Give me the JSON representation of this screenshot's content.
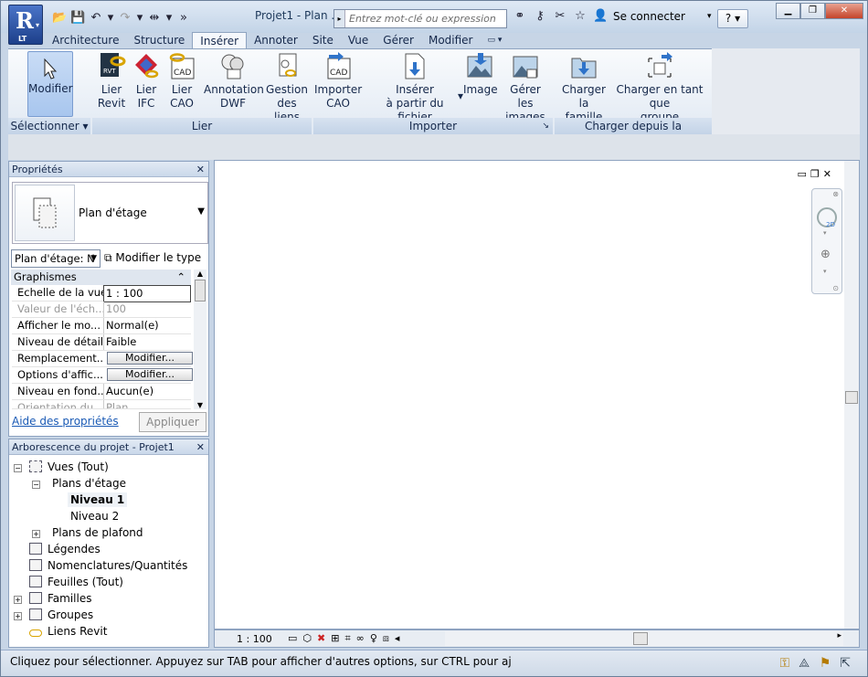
{
  "app": {
    "title": "Projet1 - Plan ...",
    "logo_letter": "R",
    "logo_sub": "LT"
  },
  "search": {
    "placeholder": "Entrez mot-clé ou expression"
  },
  "header": {
    "sign_in": "Se connecter",
    "help": "?"
  },
  "tabs": [
    "Architecture",
    "Structure",
    "Insérer",
    "Annoter",
    "Site",
    "Vue",
    "Gérer",
    "Modifier"
  ],
  "active_tab": "Insérer",
  "ribbon": {
    "modify": {
      "label": "Modifier"
    },
    "link_revit": {
      "l1": "Lier",
      "l2": "Revit"
    },
    "link_ifc": {
      "l1": "Lier",
      "l2": "IFC"
    },
    "link_cad": {
      "l1": "Lier",
      "l2": "CAO"
    },
    "dwf": {
      "l1": "Annotation",
      "l2": "DWF"
    },
    "manage_links": {
      "l1": "Gestion",
      "l2": "des liens"
    },
    "import_cad": {
      "l1": "Importer",
      "l2": "CAO"
    },
    "insert_file": {
      "l1": "Insérer",
      "l2": "à partir du fichier"
    },
    "image": {
      "label": "Image"
    },
    "manage_images": {
      "l1": "Gérer",
      "l2": "les images"
    },
    "load_family": {
      "l1": "Charger",
      "l2": "la famille"
    },
    "load_group": {
      "l1": "Charger en tant que",
      "l2": "groupe"
    },
    "panels": {
      "select": "Sélectionner",
      "link": "Lier",
      "import": "Importer",
      "load": "Charger depuis la bibliothèque"
    }
  },
  "properties": {
    "title": "Propriétés",
    "type_name": "Plan d'étage",
    "instance_filter": "Plan d'étage: N",
    "edit_type": "Modifier le type",
    "section": "Graphismes",
    "rows": [
      {
        "k": "Echelle de la vue",
        "v": "1 : 100"
      },
      {
        "k": "Valeur de l'éch...",
        "v": "100"
      },
      {
        "k": "Afficher le mo...",
        "v": "Normal(e)"
      },
      {
        "k": "Niveau de détail",
        "v": "Faible"
      },
      {
        "k": "Remplacement...",
        "v": "Modifier..."
      },
      {
        "k": "Options d'affic...",
        "v": "Modifier..."
      },
      {
        "k": "Niveau en fond...",
        "v": "Aucun(e)"
      },
      {
        "k": "Orientation du",
        "v": "Plan"
      }
    ],
    "help_link": "Aide des propriétés",
    "apply": "Appliquer"
  },
  "browser": {
    "title": "Arborescence du projet - Projet1",
    "items": [
      "Vues (Tout)",
      "Plans d'étage",
      "Niveau 1",
      "Niveau 2",
      "Plans de plafond",
      "Légendes",
      "Nomenclatures/Quantités",
      "Feuilles (Tout)",
      "Familles",
      "Groupes",
      "Liens Revit"
    ]
  },
  "view": {
    "scale": "1 : 100"
  },
  "status": {
    "text": "Cliquez pour sélectionner. Appuyez sur TAB pour afficher d'autres options, sur CTRL pour aj"
  }
}
